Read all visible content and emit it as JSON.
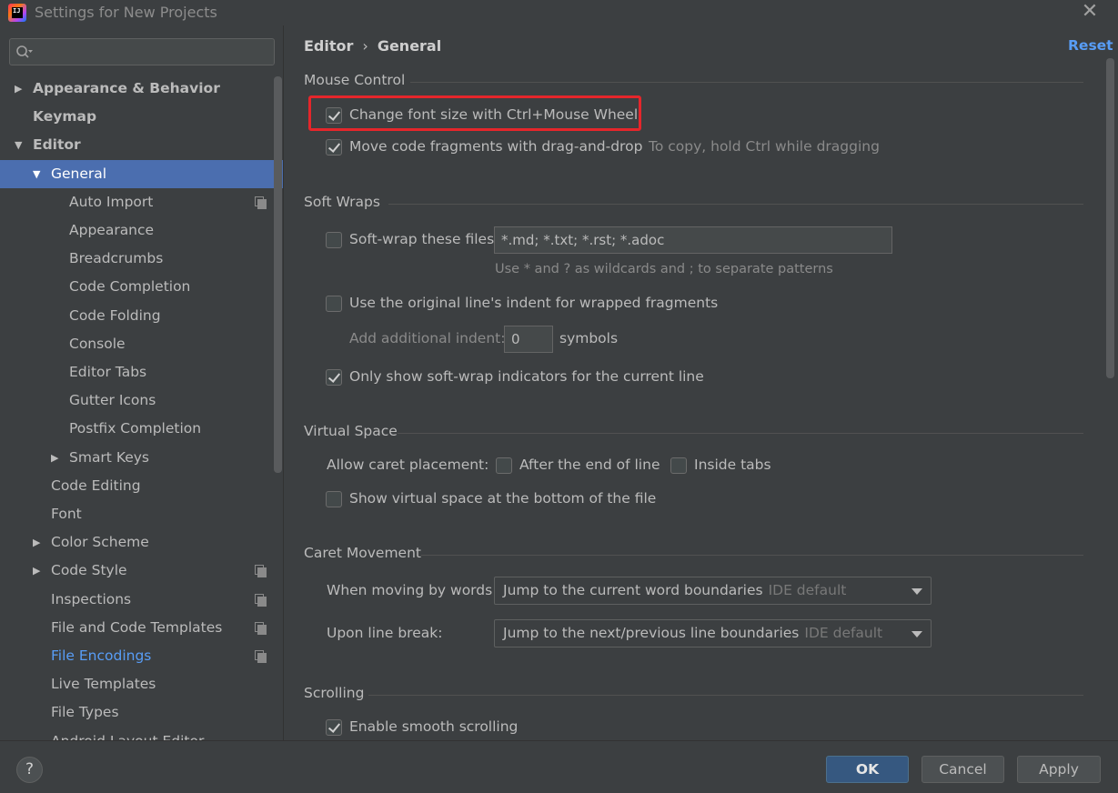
{
  "window": {
    "title": "Settings for New Projects"
  },
  "sidebar": {
    "search_placeholder": "",
    "items": [
      {
        "label": "Appearance & Behavior",
        "level": 0,
        "arrow": "▶",
        "bold": true
      },
      {
        "label": "Keymap",
        "level": 0,
        "arrow": "",
        "bold": true
      },
      {
        "label": "Editor",
        "level": 0,
        "arrow": "▼",
        "bold": true
      },
      {
        "label": "General",
        "level": 1,
        "arrow": "▼",
        "selected": true
      },
      {
        "label": "Auto Import",
        "level": 2,
        "icon": true
      },
      {
        "label": "Appearance",
        "level": 2
      },
      {
        "label": "Breadcrumbs",
        "level": 2
      },
      {
        "label": "Code Completion",
        "level": 2
      },
      {
        "label": "Code Folding",
        "level": 2
      },
      {
        "label": "Console",
        "level": 2
      },
      {
        "label": "Editor Tabs",
        "level": 2
      },
      {
        "label": "Gutter Icons",
        "level": 2
      },
      {
        "label": "Postfix Completion",
        "level": 2
      },
      {
        "label": "Smart Keys",
        "level": 2,
        "arrow": "▶"
      },
      {
        "label": "Code Editing",
        "level": 1
      },
      {
        "label": "Font",
        "level": 1
      },
      {
        "label": "Color Scheme",
        "level": 1,
        "arrow": "▶"
      },
      {
        "label": "Code Style",
        "level": 1,
        "arrow": "▶",
        "icon": true
      },
      {
        "label": "Inspections",
        "level": 1,
        "icon": true
      },
      {
        "label": "File and Code Templates",
        "level": 1,
        "icon": true
      },
      {
        "label": "File Encodings",
        "level": 1,
        "icon": true,
        "link": true
      },
      {
        "label": "Live Templates",
        "level": 1
      },
      {
        "label": "File Types",
        "level": 1
      },
      {
        "label": "Android Layout Editor",
        "level": 1
      }
    ]
  },
  "breadcrumb": {
    "parent": "Editor",
    "separator": "›",
    "current": "General"
  },
  "reset_label": "Reset",
  "sections": {
    "mouse_control": {
      "title": "Mouse Control",
      "change_font_size": {
        "label": "Change font size with Ctrl+Mouse Wheel",
        "checked": true
      },
      "move_code": {
        "label": "Move code fragments with drag-and-drop",
        "checked": true,
        "hint": "To copy, hold Ctrl while dragging"
      }
    },
    "soft_wraps": {
      "title": "Soft Wraps",
      "soft_wrap_files": {
        "label": "Soft-wrap these files:",
        "checked": false,
        "value": "*.md; *.txt; *.rst; *.adoc"
      },
      "wildcard_hint": "Use * and ? as wildcards and ; to separate patterns",
      "original_indent": {
        "label": "Use the original line's indent for wrapped fragments",
        "checked": false
      },
      "additional_indent": {
        "label": "Add additional indent:",
        "value": "0",
        "unit": "symbols"
      },
      "only_current_line": {
        "label": "Only show soft-wrap indicators for the current line",
        "checked": true
      }
    },
    "virtual_space": {
      "title": "Virtual Space",
      "caret_label": "Allow caret placement:",
      "after_end": {
        "label": "After the end of line",
        "checked": false
      },
      "inside_tabs": {
        "label": "Inside tabs",
        "checked": false
      },
      "show_bottom": {
        "label": "Show virtual space at the bottom of the file",
        "checked": false
      }
    },
    "caret_movement": {
      "title": "Caret Movement",
      "by_words": {
        "label": "When moving by words:",
        "value": "Jump to the current word boundaries",
        "hint": "IDE default"
      },
      "line_break": {
        "label": "Upon line break:",
        "value": "Jump to the next/previous line boundaries",
        "hint": "IDE default"
      }
    },
    "scrolling": {
      "title": "Scrolling",
      "smooth": {
        "label": "Enable smooth scrolling",
        "checked": true
      }
    }
  },
  "footer": {
    "help": "?",
    "ok": "OK",
    "cancel": "Cancel",
    "apply": "Apply"
  },
  "colors": {
    "accent": "#4b6eaf",
    "link": "#589df6",
    "highlight": "#e5262b",
    "background": "#3c3f41"
  },
  "icons": {
    "app": "intellij-icon",
    "search": "search-icon",
    "close": "close-icon",
    "help": "help-icon",
    "copy": "copy-icon"
  }
}
